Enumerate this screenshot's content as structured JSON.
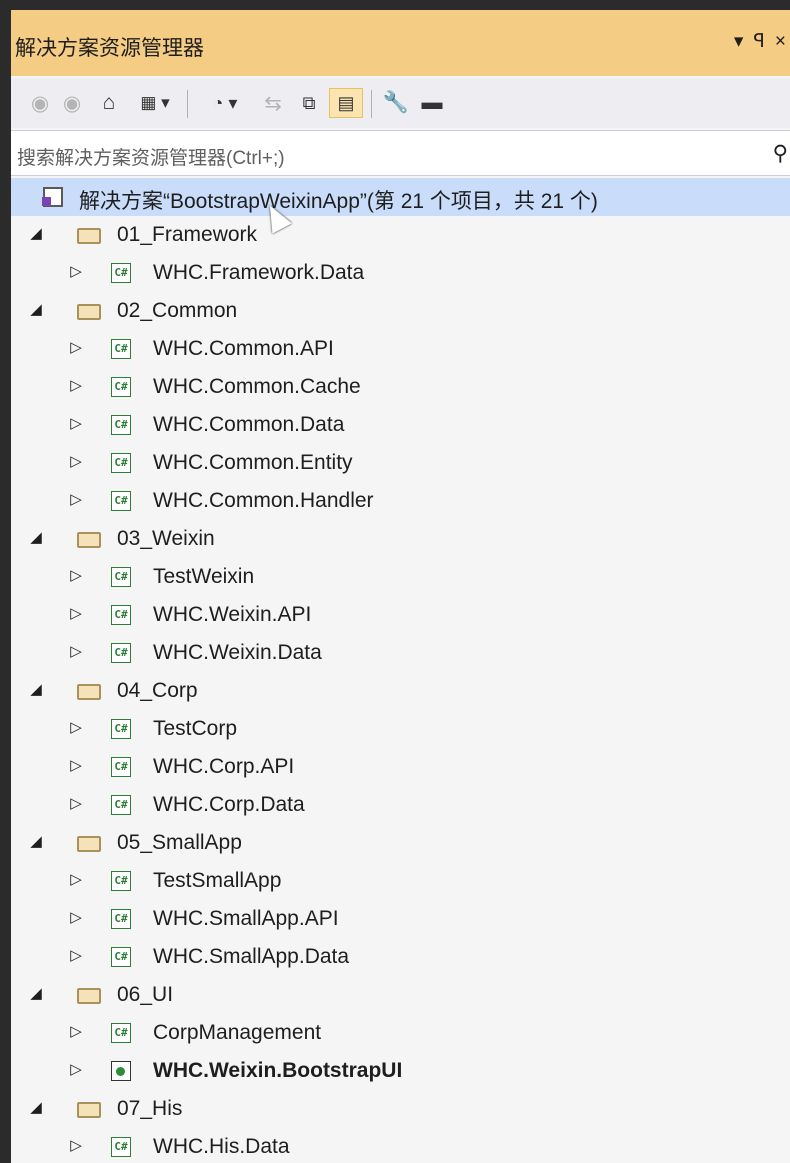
{
  "window": {
    "title": "解决方案资源管理器",
    "actions": [
      "▾",
      "ꟼ",
      "×"
    ]
  },
  "toolbar": {
    "icons": [
      "back-icon",
      "forward-icon",
      "home-icon",
      "switch-views-icon",
      "pending-changes-icon",
      "sync-icon",
      "collapse-all-icon",
      "show-all-files-icon",
      "properties-icon",
      "preview-icon"
    ]
  },
  "search": {
    "placeholder": "搜索解决方案资源管理器(Ctrl+;)"
  },
  "solution": {
    "label": "解决方案“BootstrapWeixinApp”(第 21 个项目，共 21 个)"
  },
  "folders": [
    {
      "label": "01_Framework",
      "projects": [
        "WHC.Framework.Data"
      ]
    },
    {
      "label": "02_Common",
      "projects": [
        "WHC.Common.API",
        "WHC.Common.Cache",
        "WHC.Common.Data",
        "WHC.Common.Entity",
        "WHC.Common.Handler"
      ]
    },
    {
      "label": "03_Weixin",
      "projects": [
        "TestWeixin",
        "WHC.Weixin.API",
        "WHC.Weixin.Data"
      ]
    },
    {
      "label": "04_Corp",
      "projects": [
        "TestCorp",
        "WHC.Corp.API",
        "WHC.Corp.Data"
      ]
    },
    {
      "label": "05_SmallApp",
      "projects": [
        "TestSmallApp",
        "WHC.SmallApp.API",
        "WHC.SmallApp.Data"
      ]
    },
    {
      "label": "06_UI",
      "projects": [
        "CorpManagement",
        "WHC.Weixin.BootstrapUI"
      ]
    },
    {
      "label": "07_His",
      "projects": [
        "WHC.His.Data"
      ]
    }
  ],
  "glyphs": {
    "expanded": "◢",
    "collapsed": "▷",
    "cs": "C#"
  }
}
